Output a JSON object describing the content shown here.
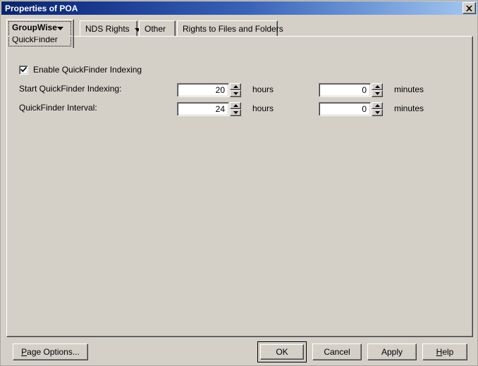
{
  "window": {
    "title": "Properties of POA",
    "close_icon": "close-x-icon"
  },
  "tabs": [
    {
      "label": "GroupWise",
      "sublabel": "QuickFinder",
      "has_dropdown": true,
      "selected": true
    },
    {
      "label": "NDS Rights",
      "has_dropdown": true,
      "selected": false
    },
    {
      "label": "Other",
      "has_dropdown": false,
      "selected": false
    },
    {
      "label": "Rights to Files and Folders",
      "has_dropdown": false,
      "selected": false
    }
  ],
  "form": {
    "enable_checkbox": {
      "label": "Enable QuickFinder Indexing",
      "checked": true
    },
    "rows": [
      {
        "label": "Start QuickFinder Indexing:",
        "hours_value": "20",
        "hours_unit": "hours",
        "minutes_value": "0",
        "minutes_unit": "minutes"
      },
      {
        "label": "QuickFinder Interval:",
        "hours_value": "24",
        "hours_unit": "hours",
        "minutes_value": "0",
        "minutes_unit": "minutes"
      }
    ]
  },
  "buttons": {
    "page_options": "Page Options...",
    "page_options_accel": "P",
    "ok": "OK",
    "cancel": "Cancel",
    "apply": "Apply",
    "help": "Help",
    "help_accel": "H"
  },
  "colors": {
    "face": "#d4d0c8",
    "title_left": "#0a246a",
    "title_right": "#a6c8f0",
    "field_bg": "#ffffff",
    "text": "#000000"
  }
}
